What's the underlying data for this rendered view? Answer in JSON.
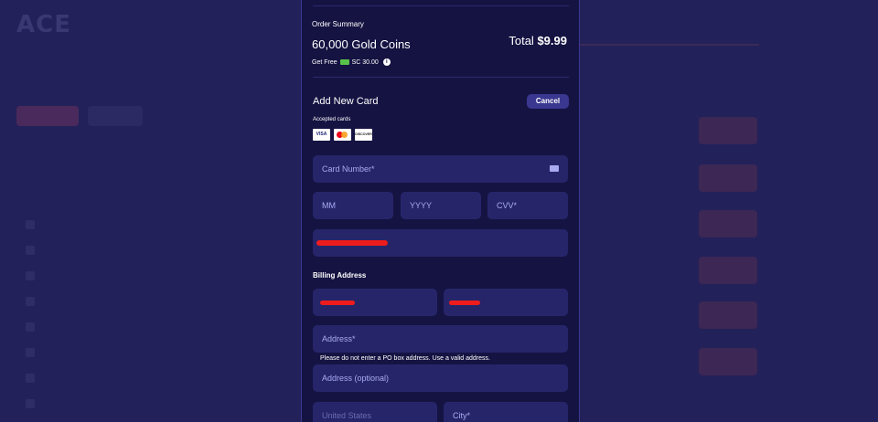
{
  "background": {
    "logo": "ACE"
  },
  "order": {
    "summary_label": "Order Summary",
    "product": "60,000 Gold Coins",
    "total_label": "Total",
    "total_value": "$9.99",
    "free_label": "Get Free",
    "free_value": "SC 30.00"
  },
  "card_form": {
    "title": "Add New Card",
    "cancel_label": "Cancel",
    "accepted_label": "Accepted cards",
    "accepted_cards": [
      "VISA",
      "Mastercard",
      "DISCOVER"
    ],
    "card_number_placeholder": "Card Number*",
    "month_placeholder": "MM",
    "year_placeholder": "YYYY",
    "cvv_placeholder": "CVV*"
  },
  "billing": {
    "title": "Billing Address",
    "address_placeholder": "Address*",
    "address_hint": "Please do not enter a PO box address. Use a valid address.",
    "address2_placeholder": "Address (optional)",
    "country_value": "United States",
    "city_placeholder": "City*"
  },
  "colors": {
    "modal_bg": "#151342",
    "field_bg": "#27256a",
    "accent_button": "#3a3790",
    "redaction": "#ee1c1c"
  }
}
